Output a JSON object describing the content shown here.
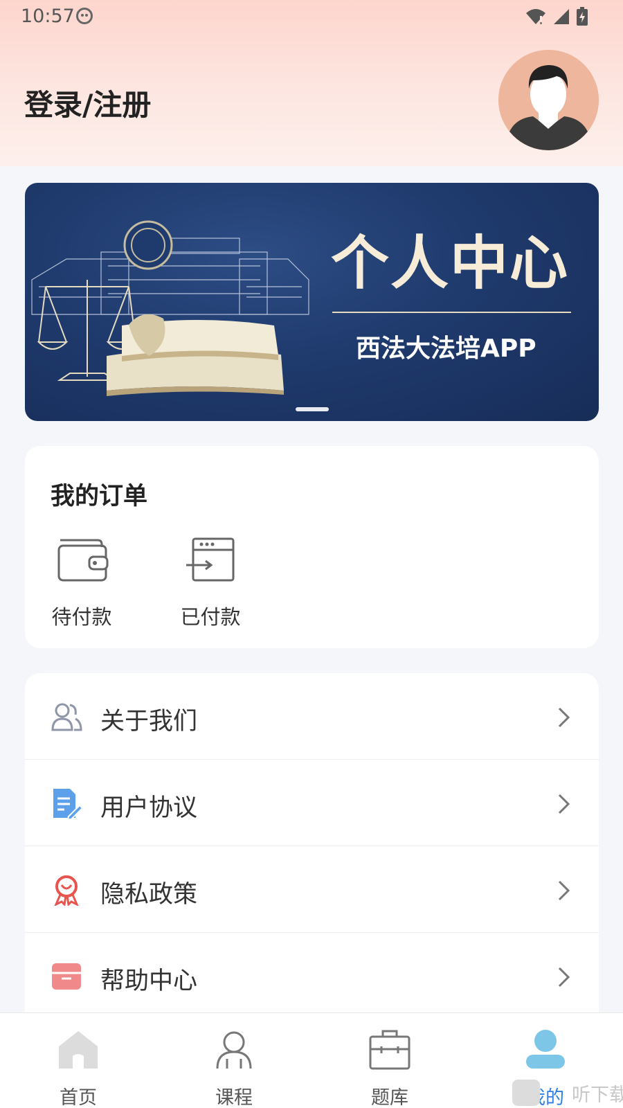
{
  "status_bar": {
    "time": "10:57"
  },
  "header": {
    "login_label": "登录/注册"
  },
  "banner": {
    "title": "个人中心",
    "subtitle": "西法大法培APP"
  },
  "orders": {
    "title": "我的订单",
    "items": [
      {
        "label": "待付款",
        "icon": "wallet-icon"
      },
      {
        "label": "已付款",
        "icon": "window-transfer-icon"
      }
    ]
  },
  "menu": {
    "items": [
      {
        "label": "关于我们",
        "icon": "users-icon",
        "color": "#8e96a8"
      },
      {
        "label": "用户协议",
        "icon": "document-edit-icon",
        "color": "#5ba0e8"
      },
      {
        "label": "隐私政策",
        "icon": "award-icon",
        "color": "#e8554e"
      },
      {
        "label": "帮助中心",
        "icon": "store-icon",
        "color": "#f08a8a"
      }
    ]
  },
  "tabbar": {
    "items": [
      {
        "label": "首页",
        "icon": "home-icon"
      },
      {
        "label": "课程",
        "icon": "course-person-icon"
      },
      {
        "label": "题库",
        "icon": "briefcase-icon"
      },
      {
        "label": "我的",
        "icon": "user-icon",
        "active": true
      }
    ]
  },
  "watermark": {
    "text": "听下载"
  },
  "colors": {
    "accent": "#2d7ee6",
    "header_gradient_top": "#fdd5cd",
    "banner_bg": "#1f3a6d"
  }
}
